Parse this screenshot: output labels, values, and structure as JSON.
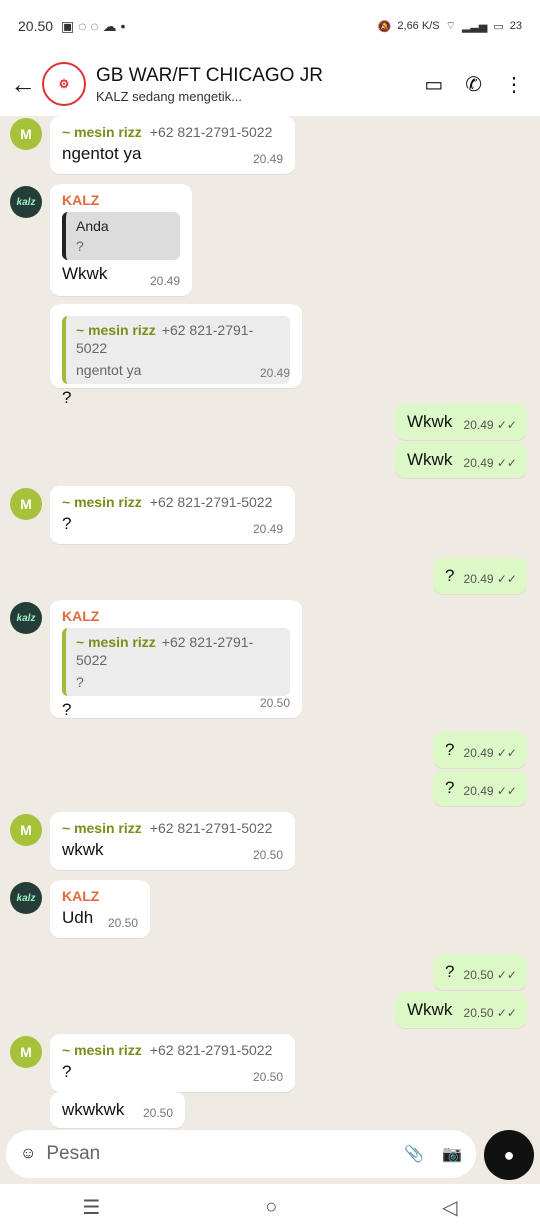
{
  "status": {
    "time": "20.50",
    "network_speed_top": "2,66",
    "network_speed_bottom": "K/S",
    "battery": "23"
  },
  "header": {
    "title": "GB WAR/FT CHICAGO JR",
    "subtitle": "KALZ sedang mengetik...",
    "back_icon": "back-icon",
    "video_icon": "video-call-icon",
    "call_icon": "call-icon",
    "menu_icon": "more-icon"
  },
  "messages": [
    {
      "id": "m1",
      "type": "incoming",
      "sender": "~ mesin rizz",
      "phone": "+62 821-2791-5022",
      "text": "ngentot ya",
      "time": "20.49"
    },
    {
      "id": "m2",
      "type": "incoming",
      "sender": "KALZ",
      "quote_author": "Anda",
      "quote_text": "?",
      "text": "Wkwk",
      "time": "20.49"
    },
    {
      "id": "m3",
      "type": "incoming",
      "quote_name": "~ mesin rizz",
      "quote_phone": "+62 821-2791-5022",
      "quote_text": "ngentot ya",
      "text": "?",
      "time": "20.49"
    },
    {
      "id": "m4",
      "type": "outgoing",
      "text": "Wkwk",
      "time": "20.49"
    },
    {
      "id": "m5",
      "type": "outgoing",
      "text": "Wkwk",
      "time": "20.49"
    },
    {
      "id": "m6",
      "type": "incoming",
      "sender": "~ mesin rizz",
      "phone": "+62 821-2791-5022",
      "text": "?",
      "time": "20.49"
    },
    {
      "id": "m7",
      "type": "outgoing",
      "text": "?",
      "time": "20.49"
    },
    {
      "id": "m8",
      "type": "incoming",
      "sender": "KALZ",
      "quote_name": "~ mesin rizz",
      "quote_phone": "+62 821-2791-5022",
      "quote_text": "?",
      "text": "?",
      "time": "20.50"
    },
    {
      "id": "m9",
      "type": "outgoing",
      "text": "?",
      "time": "20.49"
    },
    {
      "id": "m10",
      "type": "outgoing",
      "text": "?",
      "time": "20.49"
    },
    {
      "id": "m11",
      "type": "incoming",
      "sender": "~ mesin rizz",
      "phone": "+62 821-2791-5022",
      "text": "wkwk",
      "time": "20.50"
    },
    {
      "id": "m12",
      "type": "incoming",
      "sender": "KALZ",
      "text": "Udh",
      "time": "20.50"
    },
    {
      "id": "m13",
      "type": "outgoing",
      "text": "?",
      "time": "20.50"
    },
    {
      "id": "m14",
      "type": "outgoing",
      "text": "Wkwk",
      "time": "20.50"
    },
    {
      "id": "m15",
      "type": "incoming",
      "sender": "~ mesin rizz",
      "phone": "+62 821-2791-5022",
      "text": "?",
      "time": "20.50"
    },
    {
      "id": "m16",
      "type": "incoming",
      "text": "wkwkwk",
      "time": "20.50"
    }
  ],
  "composer": {
    "placeholder": "Pesan"
  }
}
